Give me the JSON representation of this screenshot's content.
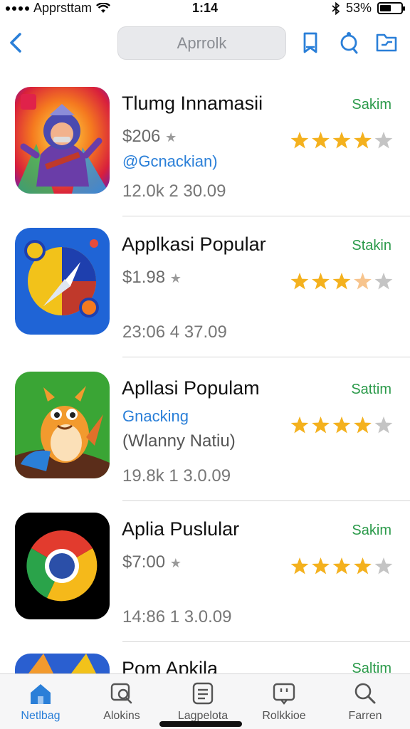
{
  "status_bar": {
    "carrier": "Apprsttam",
    "time": "1:14",
    "battery": "53%",
    "battery_level": 0.53
  },
  "nav": {
    "search_placeholder": "Aprrolk",
    "icons": [
      "chevron-left-icon",
      "bookmark-icon",
      "badge-icon",
      "inbox-icon"
    ],
    "accent": "#2a7fd8"
  },
  "apps": [
    {
      "title": "Tlumg Innamasii",
      "price": "$206",
      "subtitle": "@Gcnackian)",
      "stats": "12.0k 2   30.09",
      "get_label": "Sakim",
      "rating": 4
    },
    {
      "title": "Applkasi Popular",
      "price": "$1.98",
      "subtitle": "",
      "stats": "23:06 4   37.09",
      "get_label": "Stakin",
      "rating": 3.5
    },
    {
      "title": "Apllasi Populam",
      "price": "",
      "subtitle": "Gnacking",
      "subtitle2": "(Wlanny Natiu)",
      "stats": "19.8k 1   3.0.09",
      "get_label": "Sattim",
      "rating": 4
    },
    {
      "title": "Aplia Puslular",
      "price": "$7:00",
      "subtitle": "",
      "stats": "14:86 1   3.0.09",
      "get_label": "Sakim",
      "rating": 4
    },
    {
      "title": "Pom Apkila",
      "price": "",
      "subtitle": "",
      "stats": "",
      "get_label": "Saltim",
      "rating": 0
    }
  ],
  "tabs": [
    {
      "label": "Netlbag",
      "icon": "home-icon",
      "active": true
    },
    {
      "label": "Alokins",
      "icon": "chat-search-icon",
      "active": false
    },
    {
      "label": "Lagpelota",
      "icon": "document-icon",
      "active": false
    },
    {
      "label": "Rolkkioe",
      "icon": "card-icon",
      "active": false
    },
    {
      "label": "Farren",
      "icon": "search-icon",
      "active": false
    }
  ],
  "colors": {
    "star": "#f4b11e",
    "star_empty": "#c4c4c4",
    "get": "#2b9a4a"
  }
}
